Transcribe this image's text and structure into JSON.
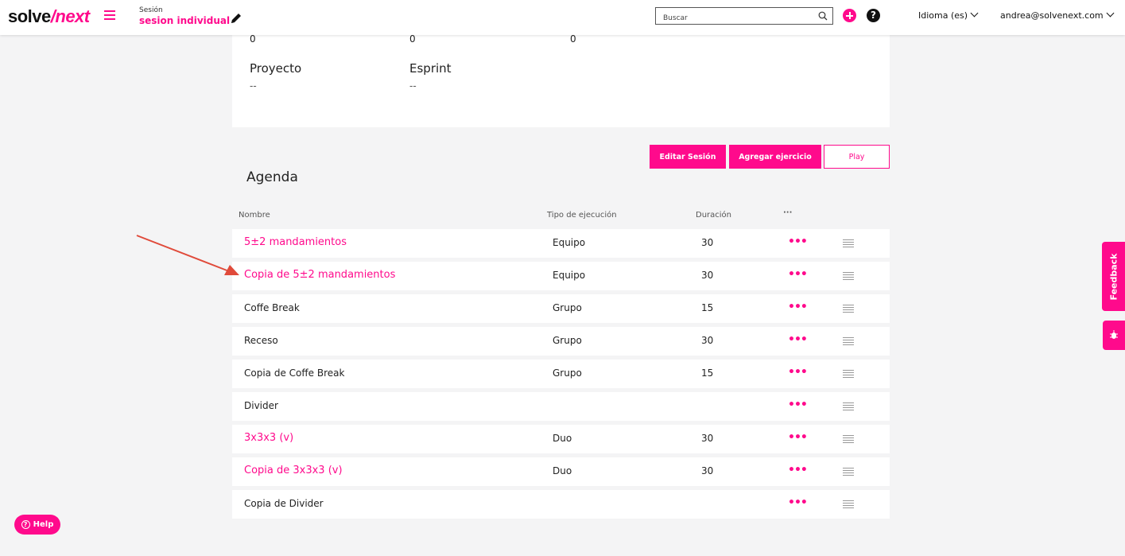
{
  "header": {
    "logo_main": "solve",
    "logo_accent": "/next",
    "session_label": "Sesión",
    "session_name": "sesion individual",
    "search_placeholder": "Buscar",
    "help_glyph": "?",
    "language": "Idioma (es)",
    "user": "andrea@solvenext.com"
  },
  "info": {
    "counts": [
      "0",
      "0",
      "0"
    ],
    "fields": [
      {
        "label": "Proyecto",
        "value": "--"
      },
      {
        "label": "Esprint",
        "value": "--"
      }
    ]
  },
  "actions": {
    "edit": "Editar Sesión",
    "add": "Agregar ejercicio",
    "play": "Play"
  },
  "agenda": {
    "title": "Agenda",
    "columns": [
      "Nombre",
      "Tipo de ejecución",
      "Duración",
      "···"
    ],
    "rows": [
      {
        "name": "5±2 mandamientos",
        "tipo": "Equipo",
        "dur": "30",
        "link": true
      },
      {
        "name": "Copia de 5±2 mandamientos",
        "tipo": "Equipo",
        "dur": "30",
        "link": true
      },
      {
        "name": "Coffe Break",
        "tipo": "Grupo",
        "dur": "15",
        "link": false
      },
      {
        "name": "Receso",
        "tipo": "Grupo",
        "dur": "30",
        "link": false
      },
      {
        "name": "Copia de Coffe Break",
        "tipo": "Grupo",
        "dur": "15",
        "link": false
      },
      {
        "name": "Divider",
        "tipo": "",
        "dur": "",
        "link": false
      },
      {
        "name": "3x3x3 (v)",
        "tipo": "Duo",
        "dur": "30",
        "link": true
      },
      {
        "name": "Copia de 3x3x3 (v)",
        "tipo": "Duo",
        "dur": "30",
        "link": true
      },
      {
        "name": "Copia de Divider",
        "tipo": "",
        "dur": "",
        "link": false
      }
    ],
    "row_menu_glyph": "•••"
  },
  "side": {
    "feedback": "Feedback",
    "help": "Help",
    "help_glyph": "?"
  },
  "colors": {
    "accent": "#ff0a8c",
    "background": "#f4f4f5"
  }
}
